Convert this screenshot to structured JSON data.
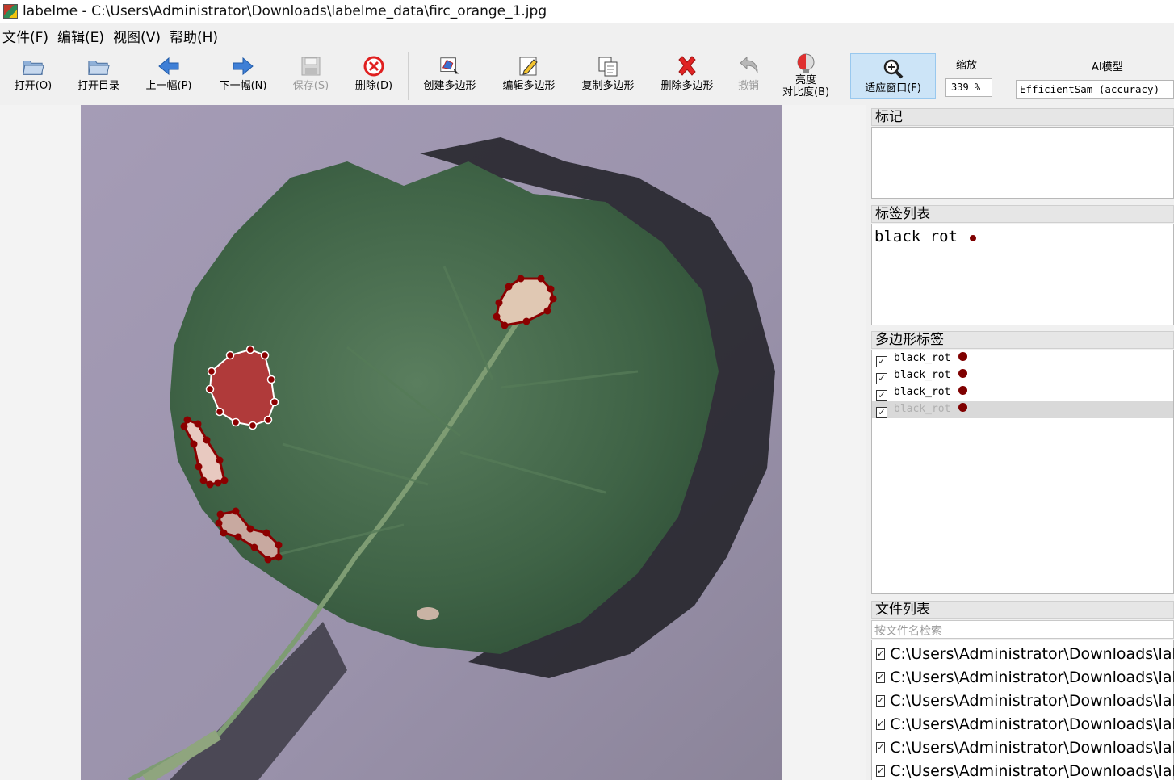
{
  "window": {
    "title": "labelme - C:\\Users\\Administrator\\Downloads\\labelme_data\\firc_orange_1.jpg"
  },
  "menu": [
    "文件(F)",
    "编辑(E)",
    "视图(V)",
    "帮助(H)"
  ],
  "toolbar": {
    "open": "打开(O)",
    "open_dir": "打开目录",
    "prev": "上一幅(P)",
    "next": "下一幅(N)",
    "save": "保存(S)",
    "delete": "删除(D)",
    "create_polygon": "创建多边形",
    "edit_polygon": "编辑多边形",
    "copy_polygon": "复制多边形",
    "delete_polygon": "删除多边形",
    "undo": "撤销",
    "brightness_line1": "亮度",
    "brightness_line2": "对比度(B)",
    "fit_window": "适应窗口(F)",
    "zoom_label": "缩放",
    "zoom_value": "339 %",
    "ai_label": "AI模型",
    "ai_value": "EfficientSam (accuracy)"
  },
  "panels": {
    "flags_title": "标记",
    "labels_title": "标签列表",
    "labels": [
      "black_rot"
    ],
    "polygons_title": "多边形标签",
    "polygons": [
      {
        "label": "black_rot",
        "checked": true,
        "selected": false
      },
      {
        "label": "black_rot",
        "checked": true,
        "selected": false
      },
      {
        "label": "black_rot",
        "checked": true,
        "selected": false
      },
      {
        "label": "black_rot",
        "checked": true,
        "selected": true
      }
    ],
    "files_title": "文件列表",
    "file_search_placeholder": "按文件名检索",
    "files": [
      "C:\\Users\\Administrator\\Downloads\\labelme_data",
      "C:\\Users\\Administrator\\Downloads\\labelme_data",
      "C:\\Users\\Administrator\\Downloads\\labelme_data",
      "C:\\Users\\Administrator\\Downloads\\labelme_data",
      "C:\\Users\\Administrator\\Downloads\\labelme_data",
      "C:\\Users\\Administrator\\Downloads\\labelme_data"
    ]
  },
  "colors": {
    "label_color": "#7f0000",
    "accent": "#cce4f7"
  }
}
